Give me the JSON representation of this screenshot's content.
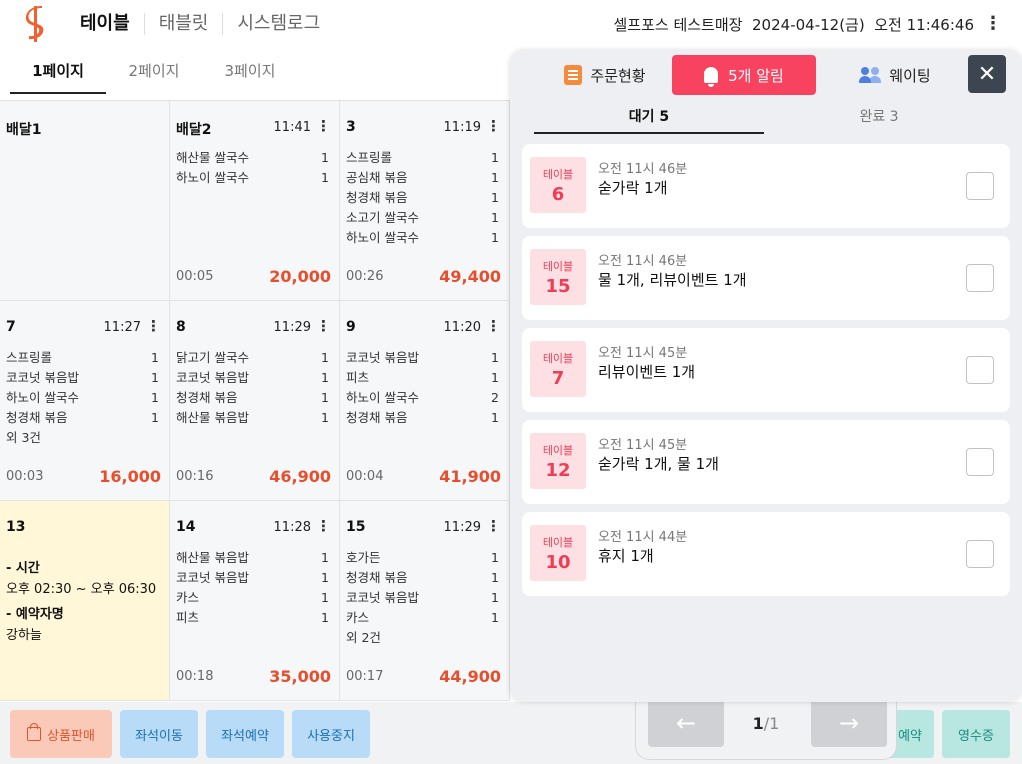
{
  "header": {
    "nav": [
      "테이블",
      "태블릿",
      "시스템로그"
    ],
    "store_name": "셀프포스 테스트매장",
    "date": "2024-04-12(금)",
    "time": "오전 11:46:46",
    "menu_icon": "more-vertical-icon",
    "brand_color": "#f06230"
  },
  "page_tabs": [
    "1페이지",
    "2페이지",
    "3페이지"
  ],
  "tables": [
    {
      "name": "배달1",
      "time": "",
      "items": [],
      "extra": "",
      "elapsed": "",
      "total": ""
    },
    {
      "name": "배달2",
      "time": "11:41",
      "items": [
        {
          "n": "해산물 쌀국수",
          "q": "1"
        },
        {
          "n": "하노이 쌀국수",
          "q": "1"
        }
      ],
      "extra": "",
      "elapsed": "00:05",
      "total": "20,000"
    },
    {
      "name": "3",
      "time": "11:19",
      "items": [
        {
          "n": "스프링롤",
          "q": "1"
        },
        {
          "n": "공심채 볶음",
          "q": "1"
        },
        {
          "n": "청경채 볶음",
          "q": "1"
        },
        {
          "n": "소고기 쌀국수",
          "q": "1"
        },
        {
          "n": "하노이 쌀국수",
          "q": "1"
        }
      ],
      "extra": "",
      "elapsed": "00:26",
      "total": "49,400"
    },
    {
      "name": "7",
      "time": "11:27",
      "items": [
        {
          "n": "스프링롤",
          "q": "1"
        },
        {
          "n": "코코넛 볶음밥",
          "q": "1"
        },
        {
          "n": "하노이 쌀국수",
          "q": "1"
        },
        {
          "n": "청경채 볶음",
          "q": "1"
        }
      ],
      "extra": "외 3건",
      "elapsed": "00:03",
      "total": "16,000"
    },
    {
      "name": "8",
      "time": "11:29",
      "items": [
        {
          "n": "닭고기 쌀국수",
          "q": "1"
        },
        {
          "n": "코코넛 볶음밥",
          "q": "1"
        },
        {
          "n": "청경채 볶음",
          "q": "1"
        },
        {
          "n": "해산물 볶음밥",
          "q": "1"
        }
      ],
      "extra": "",
      "elapsed": "00:16",
      "total": "46,900"
    },
    {
      "name": "9",
      "time": "11:20",
      "items": [
        {
          "n": "코코넛 볶음밥",
          "q": "1"
        },
        {
          "n": "피츠",
          "q": "1"
        },
        {
          "n": "하노이 쌀국수",
          "q": "2"
        },
        {
          "n": "청경채 볶음",
          "q": "1"
        }
      ],
      "extra": "",
      "elapsed": "00:04",
      "total": "41,900"
    },
    {
      "name": "13",
      "reservation": {
        "time_label": "- 시간",
        "time_value": "오후 02:30 ~ 오후 06:30",
        "name_label": "- 예약자명",
        "name_value": "강하늘"
      }
    },
    {
      "name": "14",
      "time": "11:28",
      "items": [
        {
          "n": "해산물 볶음밥",
          "q": "1"
        },
        {
          "n": "코코넛 볶음밥",
          "q": "1"
        },
        {
          "n": "카스",
          "q": "1"
        },
        {
          "n": "피츠",
          "q": "1"
        }
      ],
      "extra": "",
      "elapsed": "00:18",
      "total": "35,000"
    },
    {
      "name": "15",
      "time": "11:29",
      "items": [
        {
          "n": "호가든",
          "q": "1"
        },
        {
          "n": "청경채 볶음",
          "q": "1"
        },
        {
          "n": "코코넛 볶음밥",
          "q": "1"
        },
        {
          "n": "카스",
          "q": "1"
        }
      ],
      "extra": "외 2건",
      "elapsed": "00:17",
      "total": "44,900"
    }
  ],
  "bottom": {
    "sell": "상품판매",
    "move": "좌석이동",
    "reserve": "좌석예약",
    "stop": "사용중지",
    "partial": "예약",
    "receipt": "영수증"
  },
  "pager": {
    "current": "1",
    "total": "/1"
  },
  "panel": {
    "tab_orders": "주문현황",
    "tab_alerts": "5개 알림",
    "tab_waiting": "웨이팅",
    "subtab_waiting": "대기 5",
    "subtab_done": "완료 3",
    "accent": "#f7435f",
    "alerts": [
      {
        "label": "테이블",
        "num": "6",
        "time": "오전 11시 46분",
        "text": "숟가락 1개"
      },
      {
        "label": "테이블",
        "num": "15",
        "time": "오전 11시 46분",
        "text": "물 1개, 리뷰이벤트 1개"
      },
      {
        "label": "테이블",
        "num": "7",
        "time": "오전 11시 45분",
        "text": "리뷰이벤트 1개"
      },
      {
        "label": "테이블",
        "num": "12",
        "time": "오전 11시 45분",
        "text": "숟가락 1개, 물 1개"
      },
      {
        "label": "테이블",
        "num": "10",
        "time": "오전 11시 44분",
        "text": "휴지 1개"
      }
    ]
  }
}
